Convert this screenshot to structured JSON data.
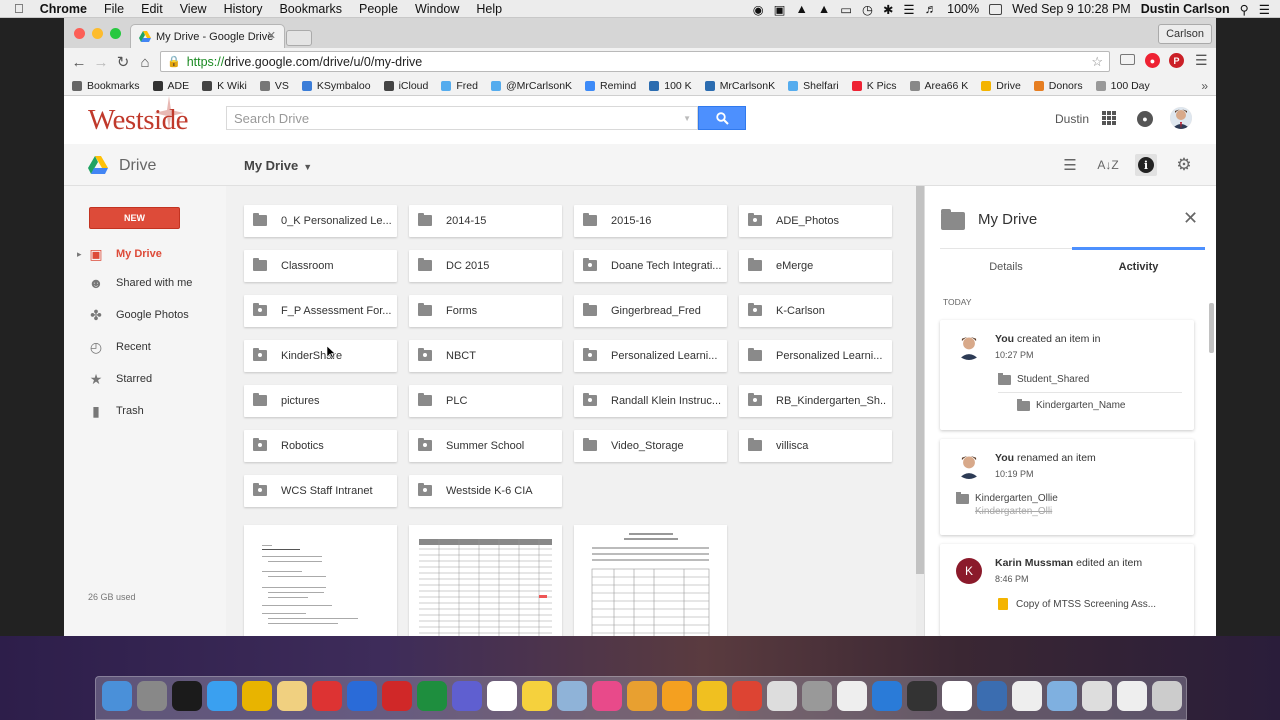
{
  "menubar": {
    "app": "Chrome",
    "items": [
      "File",
      "Edit",
      "View",
      "History",
      "Bookmarks",
      "People",
      "Window",
      "Help"
    ],
    "battery": "100%",
    "datetime": "Wed Sep 9  10:28 PM",
    "user": "Dustin Carlson"
  },
  "browser": {
    "tab_title": "My Drive - Google Drive",
    "profile": "Carlson",
    "url_scheme": "https://",
    "url_rest": "drive.google.com/drive/u/0/my-drive",
    "bookmarks": [
      {
        "label": "Bookmarks",
        "color": "#666"
      },
      {
        "label": "ADE",
        "color": "#333"
      },
      {
        "label": "K Wiki",
        "color": "#444"
      },
      {
        "label": "VS",
        "color": "#777"
      },
      {
        "label": "KSymbaloo",
        "color": "#3b7dd8"
      },
      {
        "label": "iCloud",
        "color": "#444"
      },
      {
        "label": "Fred",
        "color": "#55acee"
      },
      {
        "label": "@MrCarlsonK",
        "color": "#55acee"
      },
      {
        "label": "Remind",
        "color": "#3d8af7"
      },
      {
        "label": "100 K",
        "color": "#2b6cb0"
      },
      {
        "label": "MrCarlsonK",
        "color": "#2b6cb0"
      },
      {
        "label": "Shelfari",
        "color": "#55acee"
      },
      {
        "label": "K Pics",
        "color": "#e23"
      },
      {
        "label": "Area66 K",
        "color": "#888"
      },
      {
        "label": "Drive",
        "color": "#f4b400"
      },
      {
        "label": "Donors",
        "color": "#e67e22"
      },
      {
        "label": "100 Day",
        "color": "#999"
      }
    ]
  },
  "header": {
    "logo": "Westside",
    "search_placeholder": "Search Drive",
    "user_name": "Dustin"
  },
  "drivebar": {
    "product": "Drive",
    "location": "My Drive"
  },
  "sidebar": {
    "new_label": "NEW",
    "items": [
      {
        "label": "My Drive",
        "icon": "drive-folder-icon",
        "active": true
      },
      {
        "label": "Shared with me",
        "icon": "people-icon"
      },
      {
        "label": "Google Photos",
        "icon": "pinwheel-icon"
      },
      {
        "label": "Recent",
        "icon": "clock-icon"
      },
      {
        "label": "Starred",
        "icon": "star-icon"
      },
      {
        "label": "Trash",
        "icon": "trash-icon"
      }
    ],
    "storage": "26 GB used"
  },
  "folders": [
    {
      "name": "0_K Personalized Le...",
      "shared": false
    },
    {
      "name": "2014-15",
      "shared": false
    },
    {
      "name": "2015-16",
      "shared": false
    },
    {
      "name": "ADE_Photos",
      "shared": true
    },
    {
      "name": "Classroom",
      "shared": false
    },
    {
      "name": "DC 2015",
      "shared": false
    },
    {
      "name": "Doane Tech Integrati...",
      "shared": true
    },
    {
      "name": "eMerge",
      "shared": false
    },
    {
      "name": "F_P Assessment For...",
      "shared": true
    },
    {
      "name": "Forms",
      "shared": false
    },
    {
      "name": "Gingerbread_Fred",
      "shared": false
    },
    {
      "name": "K-Carlson",
      "shared": true
    },
    {
      "name": "KinderShare",
      "shared": true
    },
    {
      "name": "NBCT",
      "shared": true
    },
    {
      "name": "Personalized Learni...",
      "shared": true
    },
    {
      "name": "Personalized Learni...",
      "shared": false
    },
    {
      "name": "pictures",
      "shared": false
    },
    {
      "name": "PLC",
      "shared": false
    },
    {
      "name": "Randall Klein Instruc...",
      "shared": true
    },
    {
      "name": "RB_Kindergarten_Sh...",
      "shared": true
    },
    {
      "name": "Robotics",
      "shared": true
    },
    {
      "name": "Summer School",
      "shared": true
    },
    {
      "name": "Video_Storage",
      "shared": false
    },
    {
      "name": "villisca",
      "shared": false
    },
    {
      "name": "WCS Staff Intranet",
      "shared": true
    },
    {
      "name": "Westside K-6 CIA",
      "shared": true
    }
  ],
  "panel": {
    "title": "My Drive",
    "tab_details": "Details",
    "tab_activity": "Activity",
    "section": "TODAY",
    "activities": [
      {
        "actor": "You",
        "action": "created an item in",
        "time": "10:27 PM",
        "item1": "Student_Shared",
        "item2": "Kindergarten_Name"
      },
      {
        "actor": "You",
        "action": "renamed an item",
        "time": "10:19 PM",
        "item1": "Kindergarten_Ollie",
        "item2": "Kindergarten_Olli"
      },
      {
        "actor": "Karin Mussman",
        "action": "edited an item",
        "time": "8:46 PM",
        "item1": "Copy of MTSS Screening Ass...",
        "avatar_letter": "K"
      }
    ]
  },
  "colors": {
    "accent_red": "#dd4b39",
    "search_blue": "#4d90fe",
    "logo_red": "#c0392b"
  }
}
